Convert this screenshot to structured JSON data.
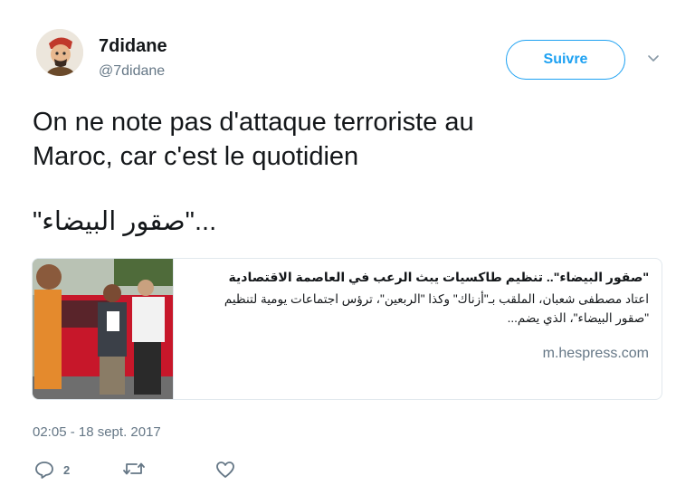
{
  "user": {
    "display_name": "7didane",
    "handle": "@7didane",
    "follow_label": "Suivre"
  },
  "tweet": {
    "lines": [
      "On ne note pas d'attaque terroriste au",
      "Maroc, car c'est le quotidien"
    ],
    "quote": "\"صقور البيضاء\"..."
  },
  "card": {
    "title": "\"صقور البيضاء\".. تنظيم طاكسيات يبث الرعب في العاصمة الاقتصادية",
    "description_lines": [
      "اعتاد مصطفى شعبان، الملقب بـ\"أزناك\" وكذا \"الربعين\"، ترؤس اجتماعات يومية لتنظيم",
      "\"صقور البيضاء\"، الذي يضم..."
    ],
    "domain": "m.hespress.com"
  },
  "timestamp": "02:05 - 18 sept. 2017",
  "actions": {
    "reply": {
      "icon": "reply-icon",
      "count": "2"
    },
    "retweet": {
      "icon": "retweet-icon"
    },
    "like": {
      "icon": "heart-icon"
    }
  },
  "colors": {
    "accent": "#1da1f2",
    "secondary_text": "#657786",
    "border": "#e1e8ed"
  }
}
